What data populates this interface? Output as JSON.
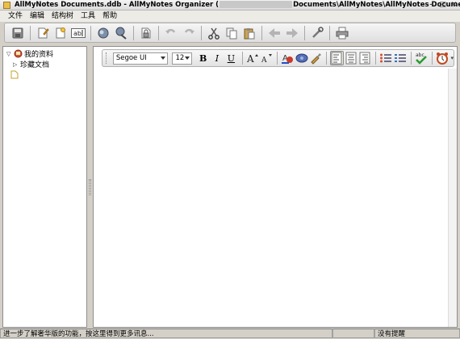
{
  "window": {
    "title_prefix": "AllMyNotes Documents.ddb - AllMyNotes Organizer (",
    "title_suffix": "Documents\\AllMyNotes\\AllMyNotes Documents.ddb)",
    "controls": [
      "–",
      "□",
      "✕"
    ]
  },
  "menu": [
    "文件",
    "编辑",
    "结构树",
    "工具",
    "帮助"
  ],
  "toolbar": {
    "buttons": [
      "save",
      "new-note",
      "new-child-note",
      "rename",
      "search",
      "find-replace",
      "lock",
      "undo",
      "redo",
      "cut",
      "copy",
      "paste",
      "back",
      "forward",
      "attach",
      "print"
    ]
  },
  "tree": {
    "root_label": "我的资料",
    "child_label": "珍藏文档"
  },
  "format": {
    "font_name": "Segoe UI",
    "font_size": "12",
    "bold": "B",
    "italic": "I",
    "underline": "U"
  },
  "status": {
    "hint": "进一步了解奢华版的功能，按这里得到更多讯息...",
    "reminder": "没有提醒"
  }
}
